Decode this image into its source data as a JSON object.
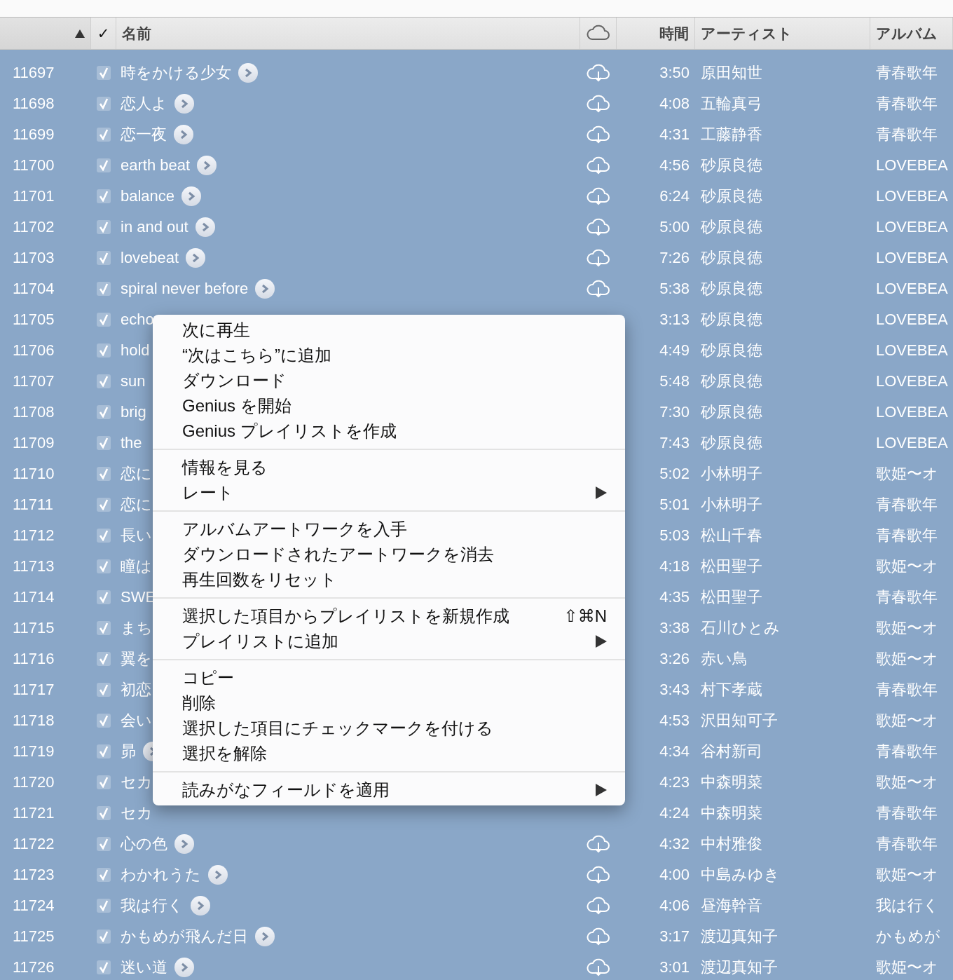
{
  "table": {
    "columns": [
      {
        "kind": "number",
        "sort_ascending": true
      },
      {
        "kind": "check",
        "label": "✓"
      },
      {
        "kind": "name",
        "label": "名前"
      },
      {
        "kind": "cloud"
      },
      {
        "kind": "time",
        "label": "時間"
      },
      {
        "kind": "artist",
        "label": "アーティスト"
      },
      {
        "kind": "album",
        "label": "アルバム"
      }
    ],
    "rows": [
      {
        "number": "11697",
        "checked": true,
        "selected": true,
        "name": "時をかける少女",
        "go_button": true,
        "cloud_icon": true,
        "time": "3:50",
        "artist": "原田知世",
        "album": "青春歌年"
      },
      {
        "number": "11698",
        "checked": true,
        "selected": true,
        "name": "恋人よ",
        "go_button": true,
        "cloud_icon": true,
        "time": "4:08",
        "artist": "五輪真弓",
        "album": "青春歌年"
      },
      {
        "number": "11699",
        "checked": true,
        "selected": true,
        "name": "恋一夜",
        "go_button": true,
        "cloud_icon": true,
        "time": "4:31",
        "artist": "工藤静香",
        "album": "青春歌年"
      },
      {
        "number": "11700",
        "checked": true,
        "selected": true,
        "name": "earth beat",
        "go_button": true,
        "cloud_icon": true,
        "time": "4:56",
        "artist": "砂原良徳",
        "album": "LOVEBEA"
      },
      {
        "number": "11701",
        "checked": true,
        "selected": true,
        "name": "balance",
        "go_button": true,
        "cloud_icon": true,
        "time": "6:24",
        "artist": "砂原良徳",
        "album": "LOVEBEA"
      },
      {
        "number": "11702",
        "checked": true,
        "selected": true,
        "name": "in and out",
        "go_button": true,
        "cloud_icon": true,
        "time": "5:00",
        "artist": "砂原良徳",
        "album": "LOVEBEA"
      },
      {
        "number": "11703",
        "checked": true,
        "selected": true,
        "name": "lovebeat",
        "go_button": true,
        "cloud_icon": true,
        "time": "7:26",
        "artist": "砂原良徳",
        "album": "LOVEBEA"
      },
      {
        "number": "11704",
        "checked": true,
        "selected": true,
        "name": "spiral never before",
        "go_button": true,
        "cloud_icon": true,
        "time": "5:38",
        "artist": "砂原良徳",
        "album": "LOVEBEA"
      },
      {
        "number": "11705",
        "checked": true,
        "selected": true,
        "name": "echo",
        "time": "3:13",
        "artist": "砂原良徳",
        "album": "LOVEBEA"
      },
      {
        "number": "11706",
        "checked": true,
        "selected": true,
        "name": "hold",
        "time": "4:49",
        "artist": "砂原良徳",
        "album": "LOVEBEA"
      },
      {
        "number": "11707",
        "checked": true,
        "selected": true,
        "name": "sun",
        "time": "5:48",
        "artist": "砂原良徳",
        "album": "LOVEBEA"
      },
      {
        "number": "11708",
        "checked": true,
        "selected": true,
        "name": "brig",
        "time": "7:30",
        "artist": "砂原良徳",
        "album": "LOVEBEA"
      },
      {
        "number": "11709",
        "checked": true,
        "selected": true,
        "name": "the",
        "time": "7:43",
        "artist": "砂原良徳",
        "album": "LOVEBEA"
      },
      {
        "number": "11710",
        "checked": true,
        "selected": true,
        "name": "恋に",
        "time": "5:02",
        "artist": "小林明子",
        "album": "歌姫〜オ"
      },
      {
        "number": "11711",
        "checked": true,
        "selected": true,
        "name": "恋に",
        "time": "5:01",
        "artist": "小林明子",
        "album": "青春歌年"
      },
      {
        "number": "11712",
        "checked": true,
        "selected": true,
        "name": "長い",
        "time": "5:03",
        "artist": "松山千春",
        "album": "青春歌年"
      },
      {
        "number": "11713",
        "checked": true,
        "selected": true,
        "name": "瞳は",
        "time": "4:18",
        "artist": "松田聖子",
        "album": "歌姫〜オ"
      },
      {
        "number": "11714",
        "checked": true,
        "selected": true,
        "name": "SWE",
        "time": "4:35",
        "artist": "松田聖子",
        "album": "青春歌年"
      },
      {
        "number": "11715",
        "checked": true,
        "selected": true,
        "name": "まち",
        "time": "3:38",
        "artist": "石川ひとみ",
        "album": "歌姫〜オ"
      },
      {
        "number": "11716",
        "checked": true,
        "selected": true,
        "name": "翼を",
        "time": "3:26",
        "artist": "赤い鳥",
        "album": "歌姫〜オ"
      },
      {
        "number": "11717",
        "checked": true,
        "selected": true,
        "name": "初恋",
        "time": "3:43",
        "artist": "村下孝蔵",
        "album": "青春歌年"
      },
      {
        "number": "11718",
        "checked": true,
        "selected": true,
        "name": "会い",
        "time": "4:53",
        "artist": "沢田知可子",
        "album": "歌姫〜オ"
      },
      {
        "number": "11719",
        "checked": true,
        "selected": true,
        "name": "昴",
        "go_button": true,
        "time": "4:34",
        "artist": "谷村新司",
        "album": "青春歌年"
      },
      {
        "number": "11720",
        "checked": true,
        "selected": true,
        "name": "セカ",
        "time": "4:23",
        "artist": "中森明菜",
        "album": "歌姫〜オ"
      },
      {
        "number": "11721",
        "checked": true,
        "selected": true,
        "name": "セカ",
        "time": "4:24",
        "artist": "中森明菜",
        "album": "青春歌年"
      },
      {
        "number": "11722",
        "checked": true,
        "selected": true,
        "name": "心の色",
        "go_button": true,
        "cloud_icon": true,
        "time": "4:32",
        "artist": "中村雅俊",
        "album": "青春歌年"
      },
      {
        "number": "11723",
        "checked": true,
        "selected": true,
        "name": "わかれうた",
        "go_button": true,
        "cloud_icon": true,
        "time": "4:00",
        "artist": "中島みゆき",
        "album": "歌姫〜オ"
      },
      {
        "number": "11724",
        "checked": true,
        "selected": true,
        "name": "我は行く",
        "go_button": true,
        "cloud_icon": true,
        "time": "4:06",
        "artist": "昼海幹音",
        "album": "我は行く"
      },
      {
        "number": "11725",
        "checked": true,
        "selected": true,
        "name": "かもめが飛んだ日",
        "go_button": true,
        "cloud_icon": true,
        "time": "3:17",
        "artist": "渡辺真知子",
        "album": "かもめが"
      },
      {
        "number": "11726",
        "checked": true,
        "selected": true,
        "name": "迷い道",
        "go_button": true,
        "cloud_icon": true,
        "time": "3:01",
        "artist": "渡辺真知子",
        "album": "歌姫〜オ"
      }
    ]
  },
  "context_menu": {
    "groups": [
      [
        {
          "label": "次に再生",
          "submenu": false
        },
        {
          "label": "“次はこちら”に追加",
          "submenu": false
        },
        {
          "label": "ダウンロード",
          "submenu": false
        },
        {
          "label": "Genius を開始",
          "submenu": false
        },
        {
          "label": "Genius プレイリストを作成",
          "submenu": false
        }
      ],
      [
        {
          "label": "情報を見る",
          "submenu": false
        },
        {
          "label": "レート",
          "submenu": true
        }
      ],
      [
        {
          "label": "アルバムアートワークを入手",
          "submenu": false
        },
        {
          "label": "ダウンロードされたアートワークを消去",
          "submenu": false
        },
        {
          "label": "再生回数をリセット",
          "submenu": false
        }
      ],
      [
        {
          "label": "選択した項目からプレイリストを新規作成",
          "shortcut": "⇧⌘N",
          "submenu": false
        },
        {
          "label": "プレイリストに追加",
          "submenu": true
        }
      ],
      [
        {
          "label": "コピー",
          "submenu": false
        },
        {
          "label": "削除",
          "submenu": false
        },
        {
          "label": "選択した項目にチェックマークを付ける",
          "submenu": false
        },
        {
          "label": "選択を解除",
          "submenu": false
        }
      ],
      [
        {
          "label": "読みがなフィールドを適用",
          "submenu": true
        }
      ]
    ]
  }
}
